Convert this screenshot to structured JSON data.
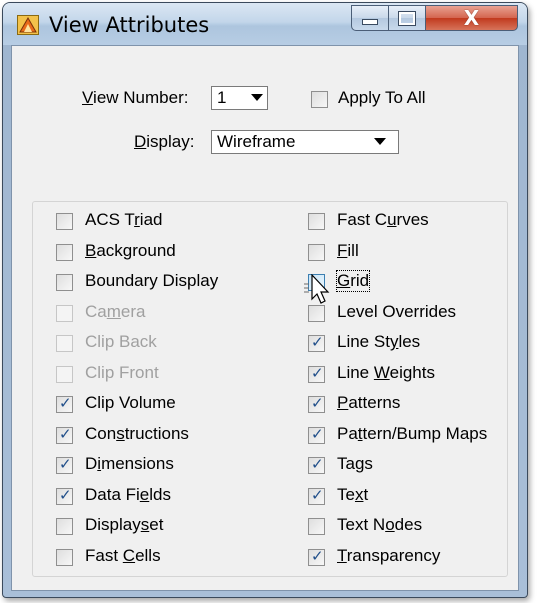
{
  "window": {
    "title": "View Attributes",
    "close_glyph": "X",
    "icon": "microstation-app-icon"
  },
  "view_number": {
    "label_prefix": "",
    "label_ul": "V",
    "label_rest": "iew Number:",
    "value": "1"
  },
  "apply_to_all": {
    "label": "Apply To All",
    "checked": false
  },
  "display": {
    "label_ul": "D",
    "label_rest": "isplay:",
    "value": "Wireframe"
  },
  "left_items": [
    {
      "pre": "ACS T",
      "ul": "r",
      "post": "iad",
      "checked": false,
      "enabled": true
    },
    {
      "pre": "",
      "ul": "B",
      "post": "ackground",
      "checked": false,
      "enabled": true
    },
    {
      "pre": "Boundary Display",
      "ul": "",
      "post": "",
      "checked": false,
      "enabled": true
    },
    {
      "pre": "Ca",
      "ul": "m",
      "post": "era",
      "checked": false,
      "enabled": false
    },
    {
      "pre": "Clip Back",
      "ul": "",
      "post": "",
      "checked": false,
      "enabled": false
    },
    {
      "pre": "Clip Front",
      "ul": "",
      "post": "",
      "checked": false,
      "enabled": false
    },
    {
      "pre": "Clip Volume",
      "ul": "",
      "post": "",
      "checked": true,
      "enabled": true
    },
    {
      "pre": "Con",
      "ul": "s",
      "post": "tructions",
      "checked": true,
      "enabled": true
    },
    {
      "pre": "D",
      "ul": "i",
      "post": "mensions",
      "checked": true,
      "enabled": true
    },
    {
      "pre": "Data Fi",
      "ul": "e",
      "post": "lds",
      "checked": true,
      "enabled": true
    },
    {
      "pre": "Display",
      "ul": "s",
      "post": "et",
      "checked": false,
      "enabled": true
    },
    {
      "pre": "Fast ",
      "ul": "C",
      "post": "ells",
      "checked": false,
      "enabled": true
    }
  ],
  "right_items": [
    {
      "pre": "Fast C",
      "ul": "u",
      "post": "rves",
      "checked": false,
      "enabled": true
    },
    {
      "pre": "",
      "ul": "F",
      "post": "ill",
      "checked": false,
      "enabled": true
    },
    {
      "pre": "",
      "ul": "G",
      "post": "rid",
      "checked": false,
      "enabled": true
    },
    {
      "pre": "Level Overrides",
      "ul": "",
      "post": "",
      "checked": false,
      "enabled": true
    },
    {
      "pre": "Line St",
      "ul": "y",
      "post": "les",
      "checked": true,
      "enabled": true
    },
    {
      "pre": "Line ",
      "ul": "W",
      "post": "eights",
      "checked": true,
      "enabled": true
    },
    {
      "pre": "",
      "ul": "P",
      "post": "atterns",
      "checked": true,
      "enabled": true
    },
    {
      "pre": "Pa",
      "ul": "t",
      "post": "tern/Bump Maps",
      "checked": true,
      "enabled": true
    },
    {
      "pre": "Tags",
      "ul": "",
      "post": "",
      "checked": true,
      "enabled": true
    },
    {
      "pre": "Te",
      "ul": "x",
      "post": "t",
      "checked": true,
      "enabled": true
    },
    {
      "pre": "Text N",
      "ul": "o",
      "post": "des",
      "checked": false,
      "enabled": true
    },
    {
      "pre": "",
      "ul": "T",
      "post": "ransparency",
      "checked": true,
      "enabled": true
    }
  ],
  "check_glyph": "✓",
  "colors": {
    "accent_check": "#214f8a",
    "close_button": "#c13a1e",
    "hover_checkbox": "#3c7fb1"
  }
}
